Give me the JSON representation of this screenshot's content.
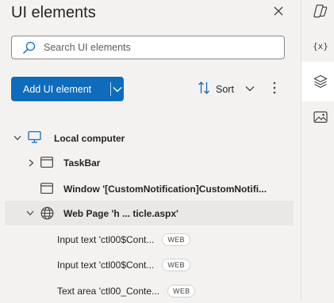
{
  "panel": {
    "title": "UI elements",
    "close_icon": "close-icon"
  },
  "search": {
    "placeholder": "Search UI elements",
    "value": "",
    "icon": "search-icon"
  },
  "toolbar": {
    "add_label": "Add UI element",
    "sort_label": "Sort",
    "icons": [
      "add-chevron-icon",
      "sort-icon",
      "chevron-down-icon",
      "more-icon"
    ]
  },
  "tree": {
    "root": {
      "label": "Local computer",
      "icon": "monitor-icon",
      "expanded": true
    },
    "items": [
      {
        "label": "TaskBar",
        "icon": "window-icon",
        "expandable": true
      },
      {
        "label": "Window '[CustomNotification]CustomNotifi...",
        "icon": "window-icon",
        "expandable": false
      },
      {
        "label": "Web Page 'h ... ticle.aspx'",
        "icon": "globe-icon",
        "expandable": true,
        "expanded": true,
        "children": [
          {
            "label": "Input text 'ctl00$Cont...",
            "badge": "WEB"
          },
          {
            "label": "Input text 'ctl00$Cont...",
            "badge": "WEB"
          },
          {
            "label": "Text area 'ctl00_Conte...",
            "badge": "WEB"
          }
        ]
      }
    ]
  },
  "rail": {
    "variables_label": "{x}",
    "icons": [
      "copilot-icon",
      "variables-icon",
      "layers-icon",
      "images-icon"
    ],
    "selected": "layers-icon"
  },
  "colors": {
    "accent": "#0f6cbd",
    "monitor": "#0f6cbd",
    "background": "#f3f2f1"
  }
}
